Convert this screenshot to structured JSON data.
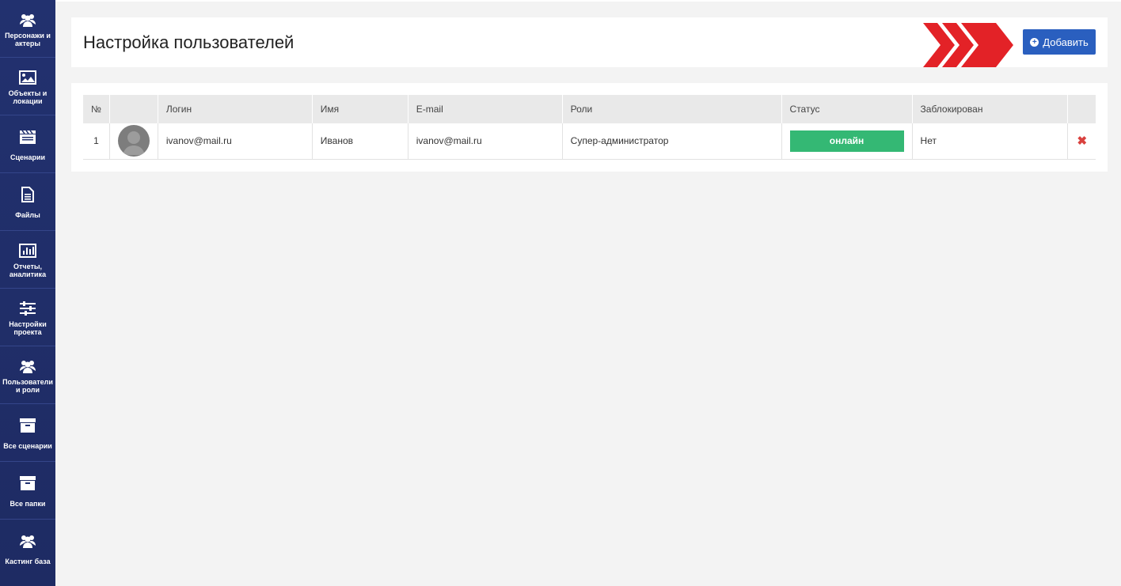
{
  "sidebar": {
    "items": [
      {
        "label": "Персонажи и актеры",
        "icon": "users-icon"
      },
      {
        "label": "Объекты и локации",
        "icon": "image-icon"
      },
      {
        "label": "Сценарии",
        "icon": "clapperboard-icon"
      },
      {
        "label": "Файлы",
        "icon": "file-icon"
      },
      {
        "label": "Отчеты, аналитика",
        "icon": "chart-icon"
      },
      {
        "label": "Настройки проекта",
        "icon": "sliders-icon"
      },
      {
        "label": "Пользователи и роли",
        "icon": "users-icon"
      },
      {
        "label": "Все сценарии",
        "icon": "archive-icon"
      },
      {
        "label": "Все папки",
        "icon": "archive-icon"
      },
      {
        "label": "Кастинг база",
        "icon": "users-icon"
      }
    ]
  },
  "header": {
    "title": "Настройка пользователей",
    "add_label": "Добавить"
  },
  "table": {
    "columns": [
      "№",
      "",
      "Логин",
      "Имя",
      "E-mail",
      "Роли",
      "Статус",
      "Заблокирован",
      ""
    ],
    "rows": [
      {
        "num": "1",
        "login": "ivanov@mail.ru",
        "name": "Иванов",
        "email": "ivanov@mail.ru",
        "role": "Супер-администратор",
        "status": "онлайн",
        "blocked": "Нет"
      }
    ]
  },
  "colors": {
    "sidebar": "#20306e",
    "accent": "#2a5fbf",
    "status_online": "#34b874",
    "chevron": "#e32227",
    "delete": "#d9413e"
  }
}
